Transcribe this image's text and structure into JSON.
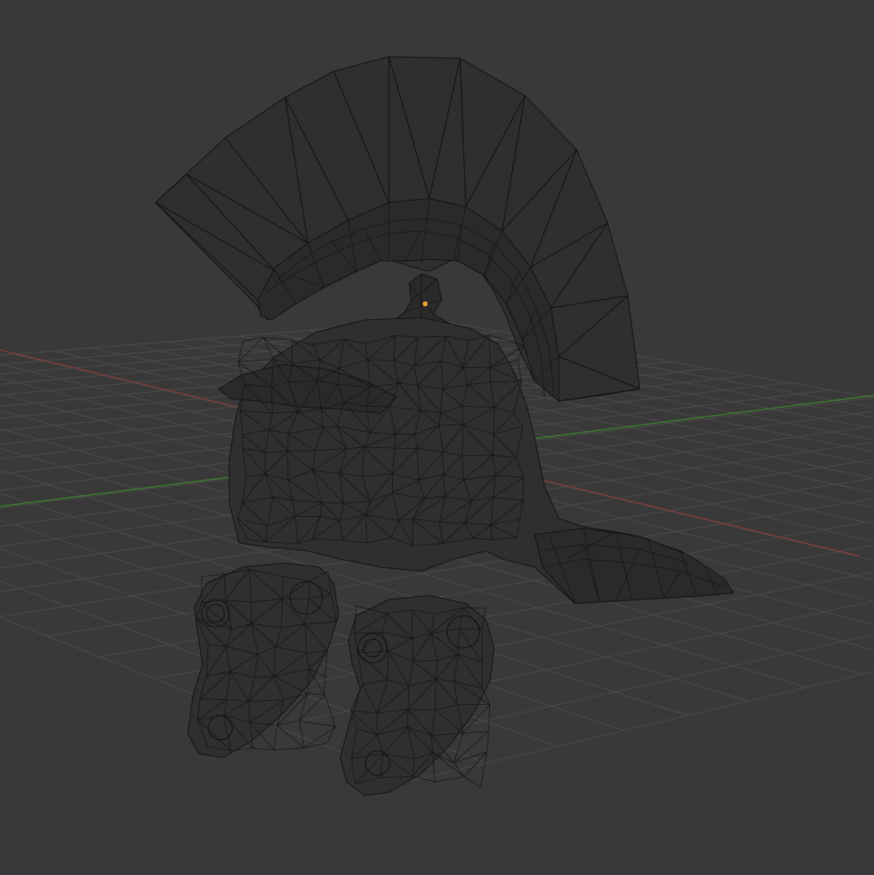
{
  "viewport": {
    "background": "#393939",
    "grid_color": "#4c4c4c",
    "x_axis_color": "#8a3a3a",
    "y_axis_color": "#3d8a2e",
    "wire_color": "#0f0f0f",
    "mesh_fill": "#2f2f2f",
    "origin_color": "#f0a030"
  },
  "scene": {
    "object": "helmet-mesh",
    "display_mode": "wireframe",
    "origin_marker_icon": "object-origin-icon"
  }
}
